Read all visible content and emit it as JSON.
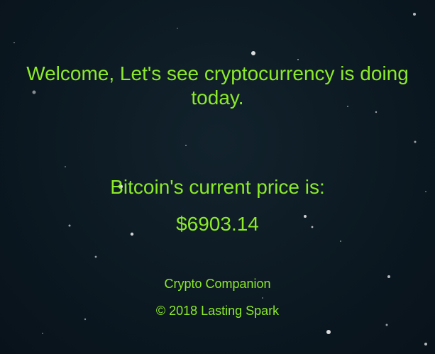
{
  "welcome_text": "Welcome, Let's see cryptocurrency is doing today.",
  "price": {
    "label": "Bitcoin's current price is:",
    "value": "$6903.14"
  },
  "footer": {
    "name": "Crypto Companion",
    "copyright": "© 2018 Lasting Spark"
  },
  "colors": {
    "text": "#8cea29",
    "background": "#0c1922"
  }
}
